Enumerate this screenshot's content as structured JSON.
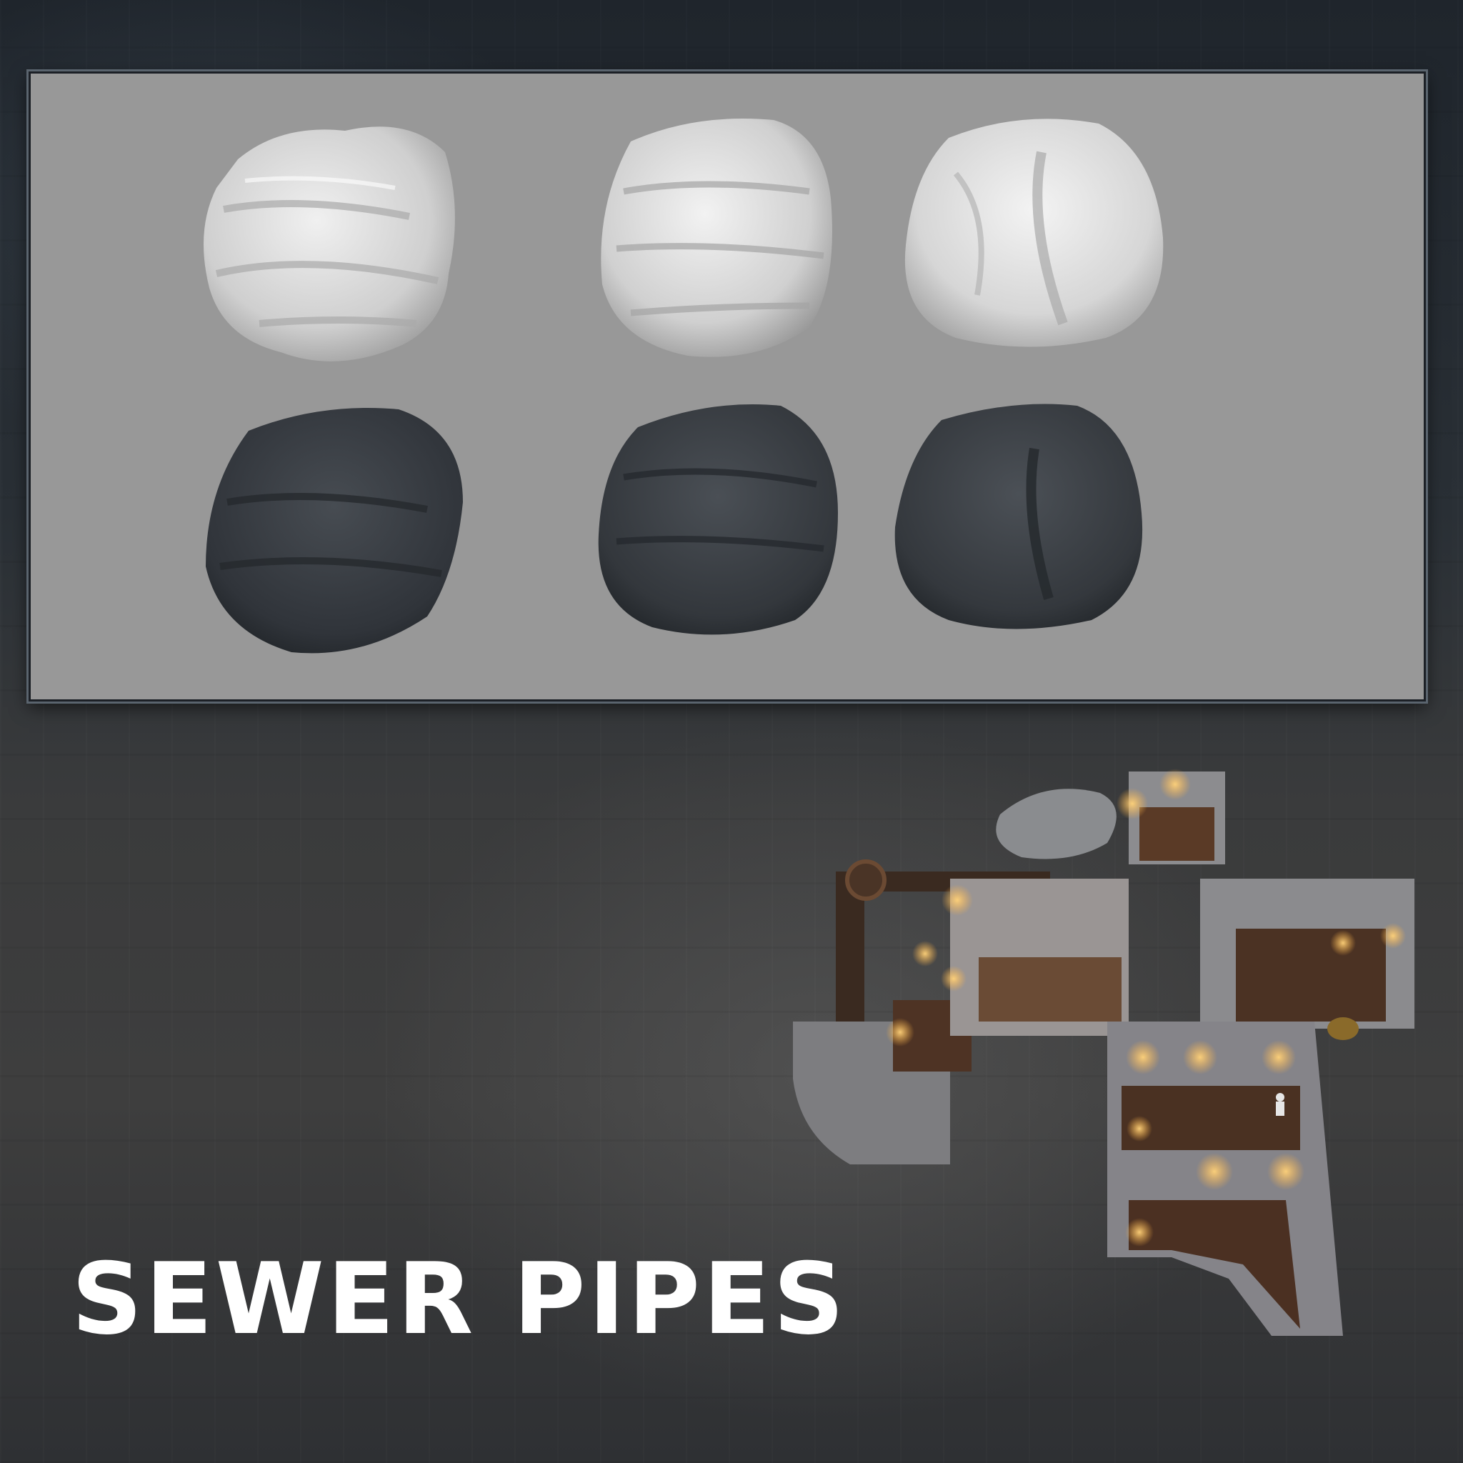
{
  "title": "SEWER PIPES",
  "panel": {
    "rocks": [
      {
        "row": "sculpt",
        "shade": "light-grey"
      },
      {
        "row": "sculpt",
        "shade": "light-grey"
      },
      {
        "row": "sculpt",
        "shade": "light-grey"
      },
      {
        "row": "textured",
        "shade": "dark-grey"
      },
      {
        "row": "textured",
        "shade": "dark-grey"
      },
      {
        "row": "textured",
        "shade": "dark-grey"
      }
    ],
    "background_color": "#989898"
  },
  "colors": {
    "sculpt_rock": "#d9d9d9",
    "textured_rock": "#34383d",
    "torch": "#f4a640",
    "floor": "#5a3a26",
    "wall": "#8b8b8e"
  }
}
